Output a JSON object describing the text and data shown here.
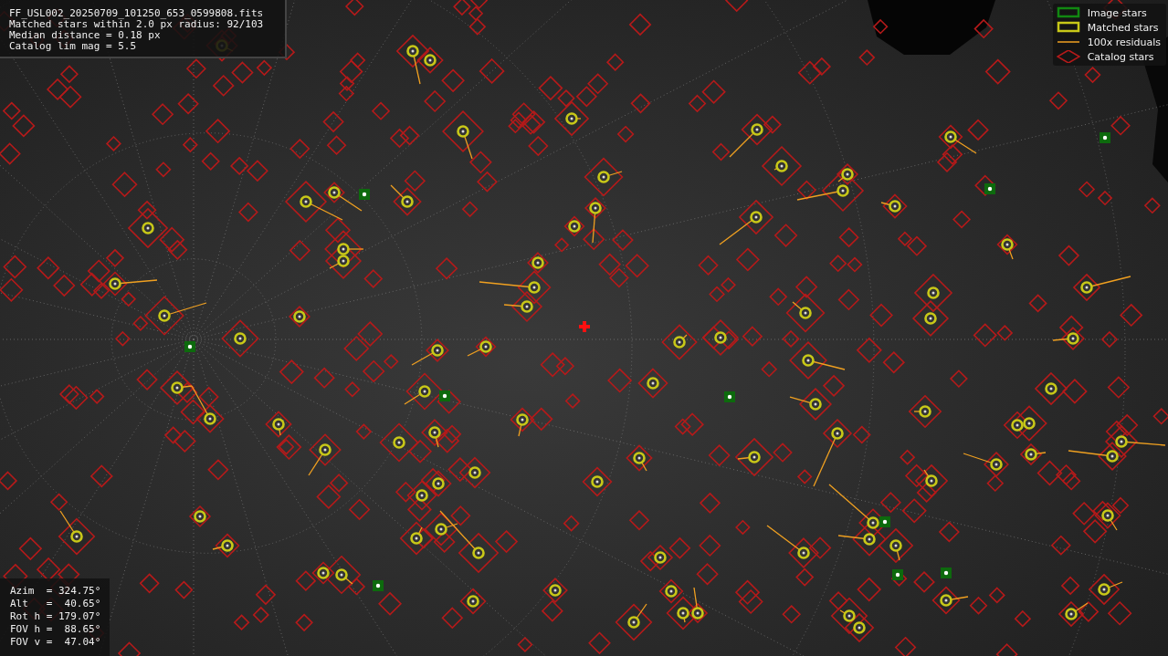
{
  "info": {
    "lines": [
      "FF_USL002_20250709_101250_653_0599808.fits",
      "Matched stars within 2.0 px radius: 92/103",
      "Median distance = 0.18 px",
      "Catalog lim mag = 5.5"
    ]
  },
  "legend": [
    {
      "kind": "image",
      "label": "Image stars"
    },
    {
      "kind": "matched",
      "label": "Matched stars"
    },
    {
      "kind": "residual",
      "label": "100x residuals"
    },
    {
      "kind": "catalog",
      "label": "Catalog stars"
    }
  ],
  "pointing": {
    "lines": [
      "Azim  = 324.75°",
      "Alt   =  40.65°",
      "Rot h = 179.07°",
      "FOV h =  88.65°",
      "FOV v =  47.04°"
    ]
  }
}
